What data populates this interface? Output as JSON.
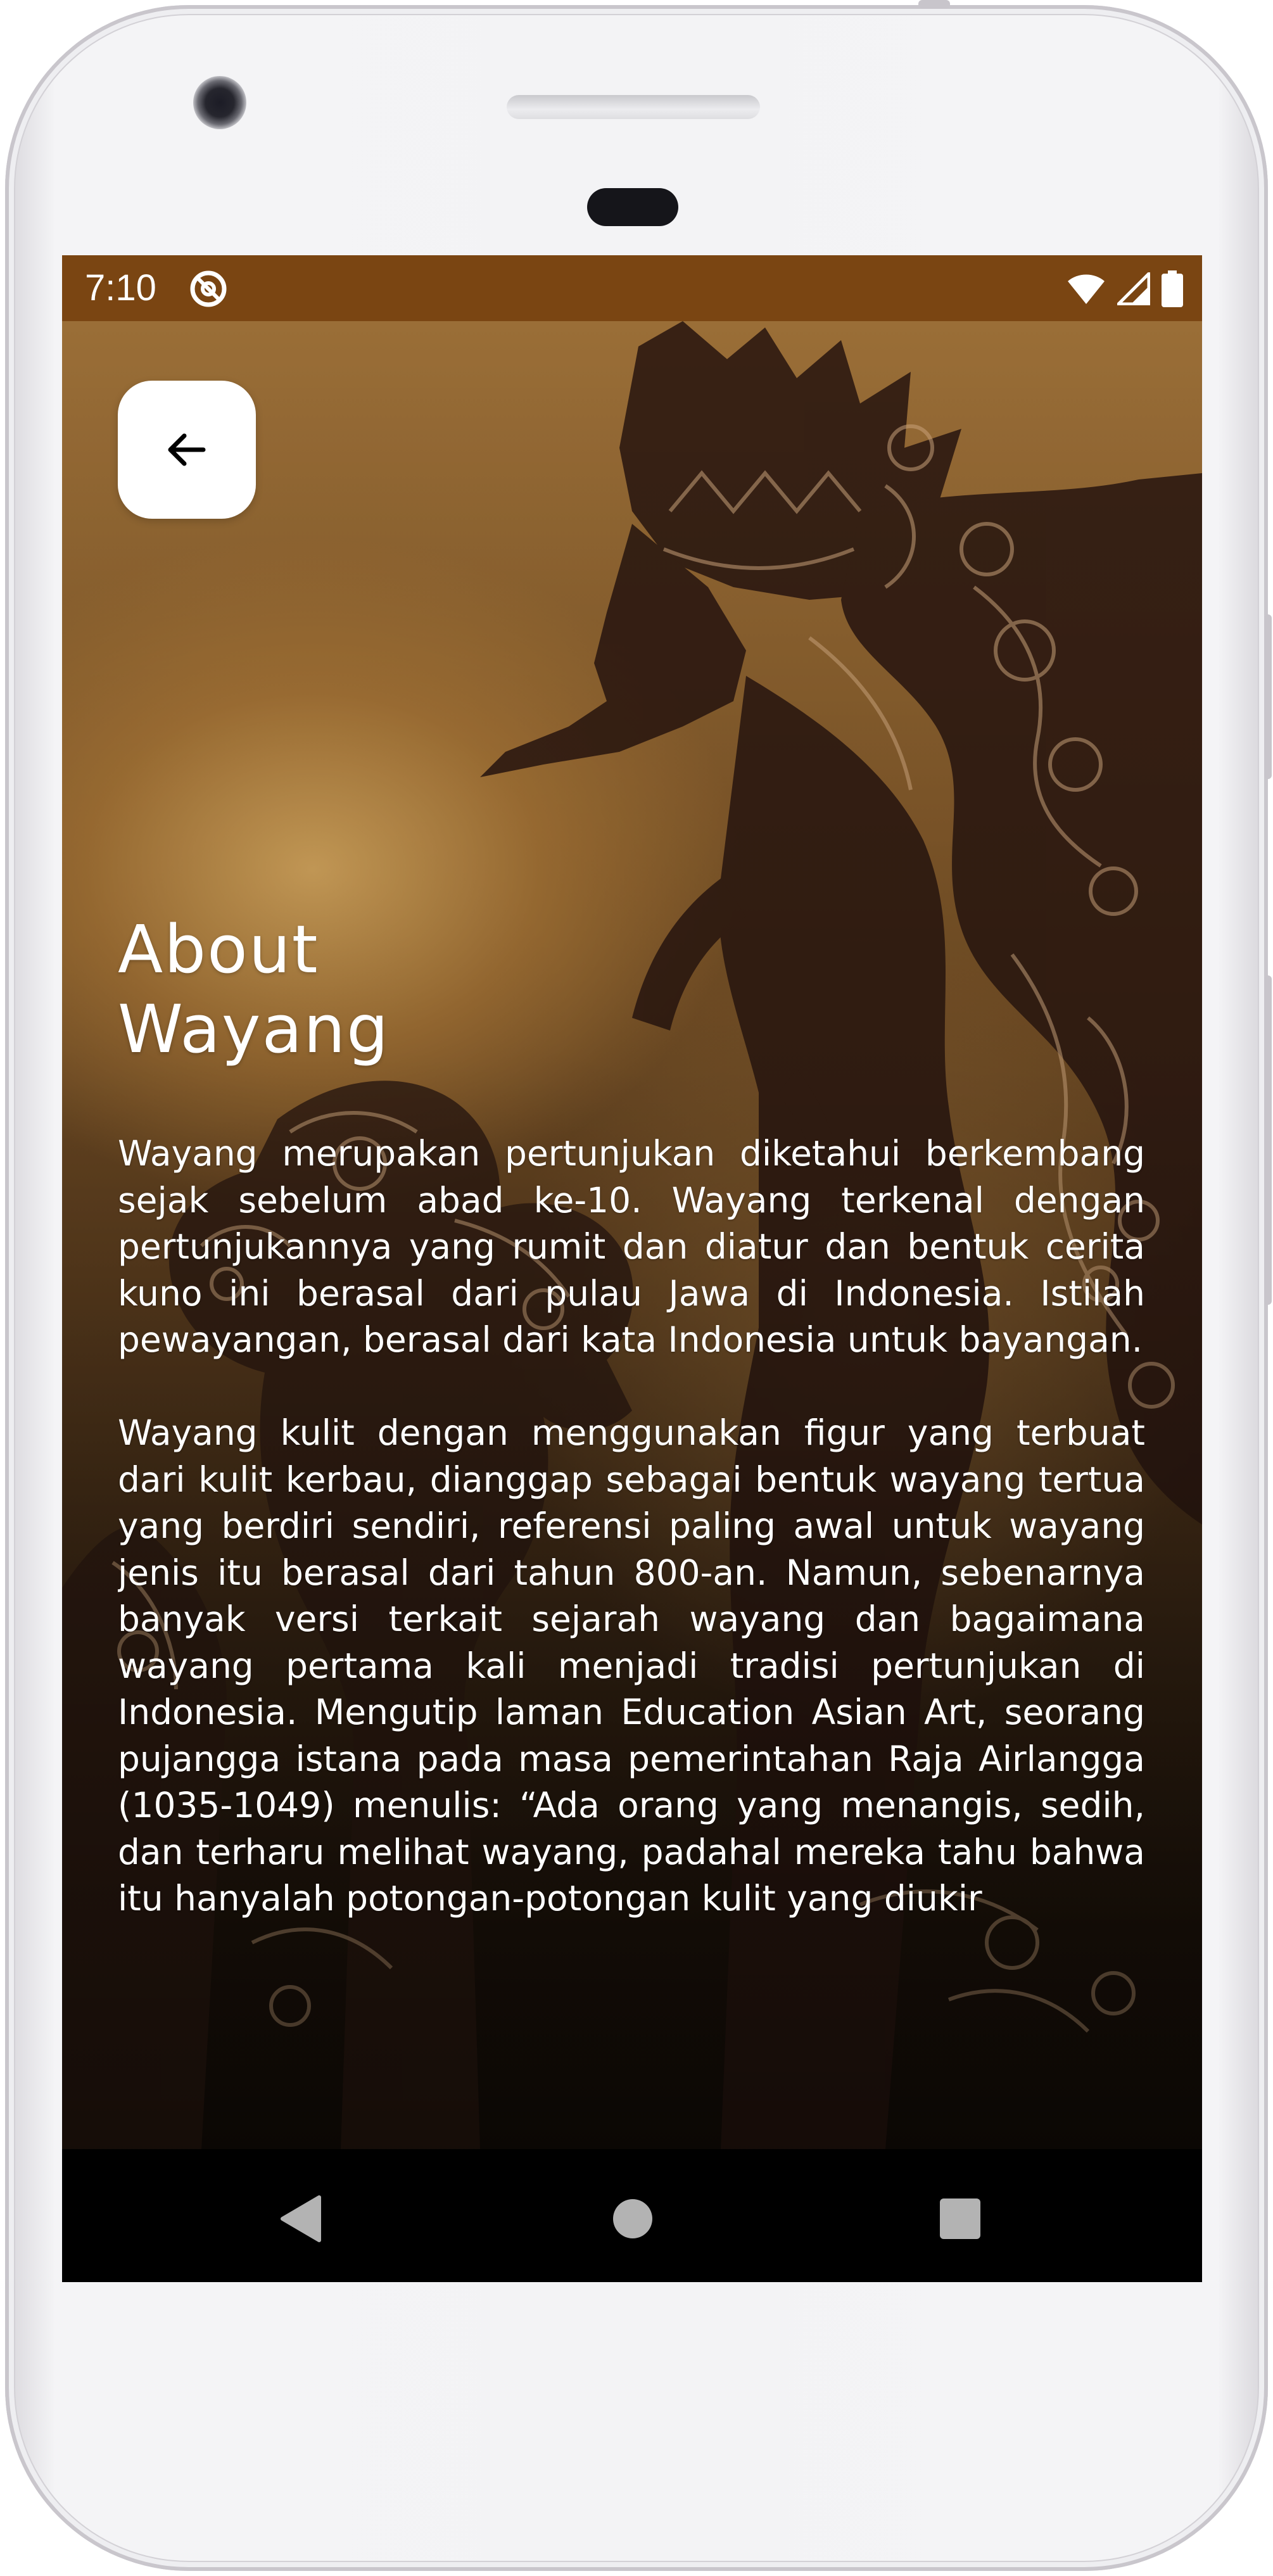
{
  "status_bar": {
    "time": "7:10",
    "background_color": "#7a4512",
    "icons": [
      "app-notification-icon",
      "wifi-icon",
      "cellular-signal-icon",
      "battery-icon"
    ]
  },
  "header": {
    "back_icon": "arrow-left-icon"
  },
  "page": {
    "title_line1": "About",
    "title_line2": "Wayang"
  },
  "article": {
    "paragraphs": [
      "Wayang merupakan pertunjukan diketahui berkembang sejak sebelum abad ke-10. Wayang terkenal dengan pertunjukannya yang rumit dan diatur dan bentuk cerita kuno ini berasal dari pulau Jawa di Indonesia. Istilah pewayangan, berasal dari kata Indonesia untuk bayangan.",
      "Wayang kulit dengan menggunakan figur yang terbuat dari kulit kerbau, dianggap sebagai bentuk wayang tertua yang berdiri sendiri, referensi paling awal untuk wayang jenis itu berasal dari tahun 800-an. Namun, sebenarnya banyak versi terkait sejarah wayang dan bagaimana wayang pertama kali menjadi tradisi pertunjukan di Indonesia. Mengutip laman Education Asian Art, seorang pujangga istana pada masa pemerintahan Raja Airlangga (1035-1049) menulis: “Ada orang yang menangis, sedih, dan terharu melihat wayang, padahal mereka tahu bahwa itu hanyalah potongan-potongan kulit yang diukir"
    ]
  },
  "nav_bar": {
    "buttons": [
      "back-triangle-icon",
      "home-circle-icon",
      "recents-square-icon"
    ]
  }
}
